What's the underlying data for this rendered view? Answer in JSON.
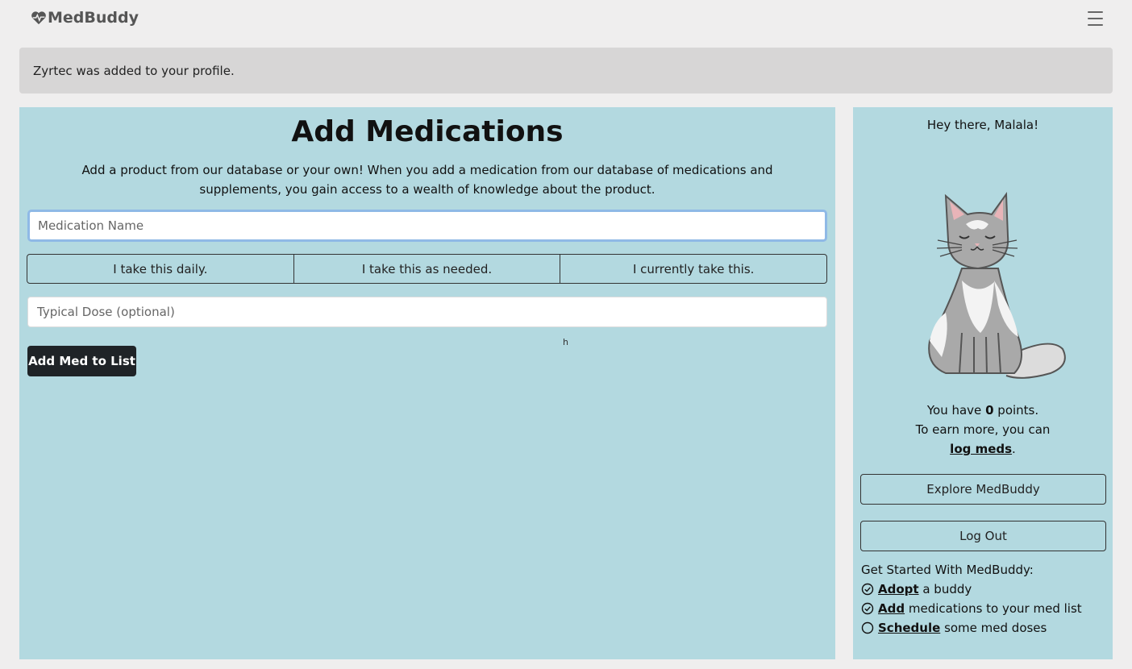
{
  "brand": {
    "name": "MedBuddy",
    "icon": "heart-pulse-icon"
  },
  "nav": {
    "menu_icon": "hamburger-icon"
  },
  "alert": {
    "message": "Zyrtec was added to your profile."
  },
  "main": {
    "title": "Add Medications",
    "intro": "Add a product from our database or your own! When you add a medication from our database of medications and supplements, you gain access to a wealth of knowledge about the product.",
    "med_name_placeholder": "Medication Name",
    "frequency_options": [
      "I take this daily.",
      "I take this as needed.",
      "I currently take this."
    ],
    "dose_placeholder": "Typical Dose (optional)",
    "submit_label": "Add Med to List",
    "stray_char": "h"
  },
  "sidebar": {
    "greeting": "Hey there, Malala!",
    "buddy_icon": "cat-illustration",
    "points_prefix": "You have",
    "points_value": "0",
    "points_suffix": "points.",
    "earn_text": "To earn more, you can",
    "earn_link": "log meds",
    "earn_end": ".",
    "explore_label": "Explore MedBuddy",
    "logout_label": "Log Out",
    "get_started_title": "Get Started With MedBuddy:",
    "checklist": [
      {
        "link": "Adopt",
        "rest": "a buddy",
        "done": true
      },
      {
        "link": "Add",
        "rest": "medications to your med list",
        "done": true
      },
      {
        "link": "Schedule",
        "rest": "some med doses",
        "done": false
      }
    ]
  }
}
